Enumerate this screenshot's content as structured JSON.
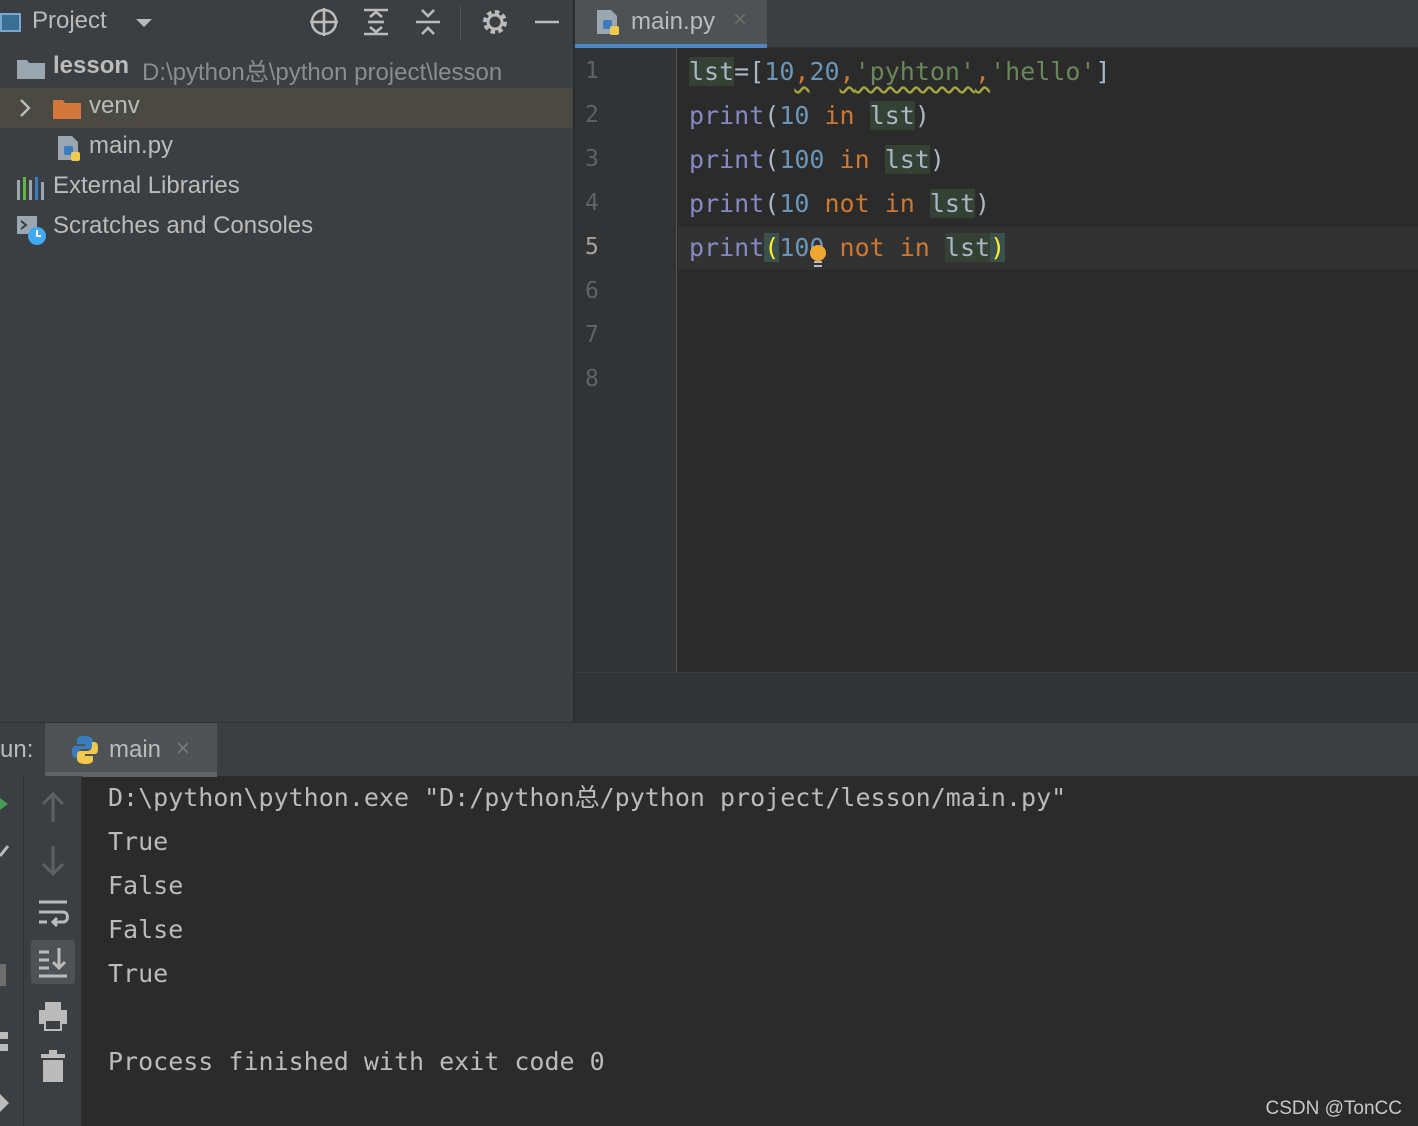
{
  "project_panel": {
    "title": "Project",
    "tree": [
      {
        "label": "lesson",
        "path": "D:\\python总\\python project\\lesson"
      },
      {
        "label": "venv"
      },
      {
        "label": "main.py"
      },
      {
        "label": "External Libraries"
      },
      {
        "label": "Scratches and Consoles"
      }
    ]
  },
  "editor": {
    "tab_label": "main.py",
    "tab_close": "×",
    "line_numbers": [
      "1",
      "2",
      "3",
      "4",
      "5",
      "6",
      "7",
      "8"
    ],
    "current_line": 5,
    "code": {
      "l1": {
        "a": "lst",
        "b": "=[",
        "c": "10",
        "d": ",",
        "e": "20",
        "f": ",",
        "g": "'pyhton'",
        "h": ",",
        "i": "'hello'",
        "j": "]"
      },
      "l2": {
        "a": "print",
        "b": "(",
        "c": "10",
        "d": " in ",
        "e": "lst",
        "f": ")"
      },
      "l3": {
        "a": "print",
        "b": "(",
        "c": "100",
        "d": " in ",
        "e": "lst",
        "f": ")"
      },
      "l4": {
        "a": "p",
        "b": "rint",
        "c": "(",
        "d": "10",
        "e": " not in ",
        "f": "lst",
        "g": ")"
      },
      "l5": {
        "a": "print",
        "b": "(",
        "c": "100",
        "d": " not in ",
        "e": "lst",
        "f": ")"
      }
    }
  },
  "run_panel": {
    "label": "un:",
    "tab_label": "main",
    "tab_close": "×",
    "console_lines": [
      "D:\\python\\python.exe \"D:/python总/python project/lesson/main.py\"",
      "True",
      "False",
      "False",
      "True",
      "",
      "Process finished with exit code 0"
    ]
  },
  "watermark": "CSDN @TonCC",
  "colors": {
    "keyword_print": "#8888c6",
    "number": "#6897bb",
    "string": "#6a8759",
    "operator": "#cc7832",
    "tab_underline": "#4a88c7",
    "folder_orange": "#d4773c"
  }
}
